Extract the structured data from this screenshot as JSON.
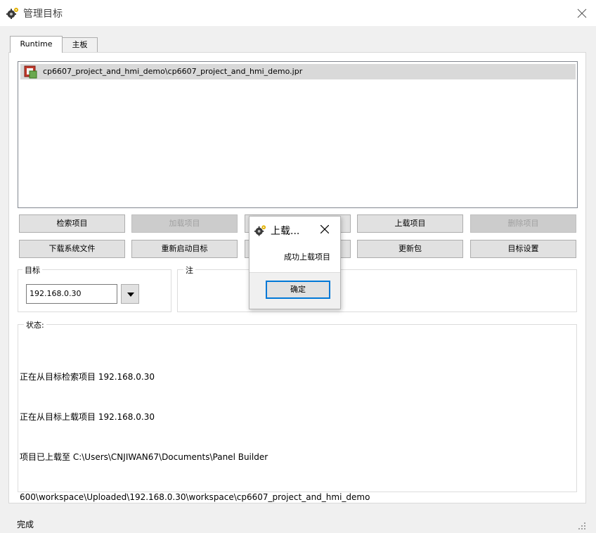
{
  "window": {
    "title": "管理目标",
    "icon": "gear-icon",
    "close_icon": "close-icon"
  },
  "tabs": [
    {
      "label": "Runtime",
      "active": true
    },
    {
      "label": "主板",
      "active": false
    }
  ],
  "project_list": {
    "items": [
      {
        "label": "cp6607_project_and_hmi_demo\\cp6607_project_and_hmi_demo.jpr",
        "icon": "project-file-icon",
        "selected": true
      }
    ]
  },
  "buttons": {
    "retrieve_project": {
      "label": "检索项目",
      "enabled": true
    },
    "load_project": {
      "label": "加载项目",
      "enabled": false
    },
    "upload_project": {
      "label": "上载项目",
      "enabled": true
    },
    "delete_project": {
      "label": "删除项目",
      "enabled": false
    },
    "download_system_files": {
      "label": "下载系统文件",
      "enabled": true
    },
    "restart_target": {
      "label": "重新启动目标",
      "enabled": true
    },
    "update_package": {
      "label": "更新包",
      "enabled": true
    },
    "target_settings": {
      "label": "目标设置",
      "enabled": true
    }
  },
  "target_group": {
    "caption": "目标",
    "ip_value": "192.168.0.30"
  },
  "note_group": {
    "caption": "注"
  },
  "status_group": {
    "caption": "状态:",
    "lines": [
      "正在从目标检索项目 192.168.0.30",
      "正在从目标上载项目 192.168.0.30",
      "项目已上载至 C:\\Users\\CNJIWAN67\\Documents\\Panel Builder",
      "600\\workspace\\Uploaded\\192.168.0.30\\workspace\\cp6607_project_and_hmi_demo"
    ]
  },
  "statusbar": {
    "text": "完成"
  },
  "dialog": {
    "title": "上载...",
    "message": "成功上载项目",
    "ok_label": "确定"
  },
  "colors": {
    "accent": "#0078d7",
    "selection": "#d9d9d9",
    "disabled_text": "#a0a0a0"
  }
}
